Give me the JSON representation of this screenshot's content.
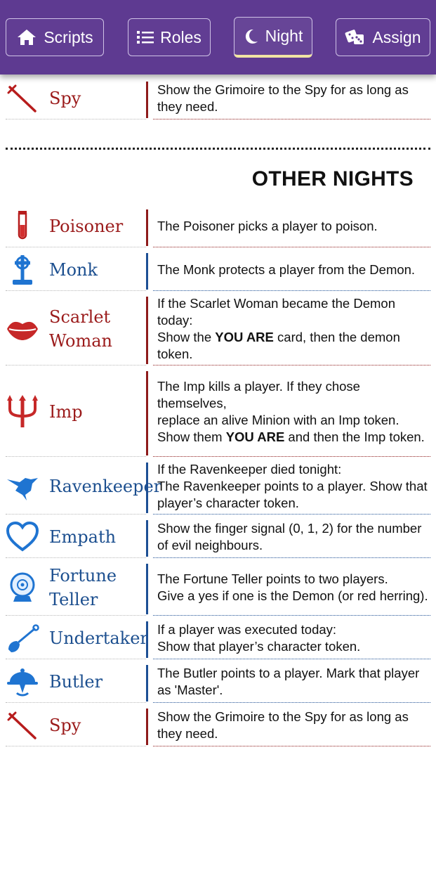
{
  "nav": {
    "scripts_label": "Scripts",
    "roles_label": "Roles",
    "night_label": "Night",
    "assign_label": "Assign",
    "active_tab": "Night",
    "bar_color": "#5e3a91"
  },
  "top_entry": {
    "name": "Spy",
    "icon": "dagger-icon",
    "team": "evil",
    "text": "Show the Grimoire to the Spy for as long as they need."
  },
  "section_title": "OTHER NIGHTS",
  "colors": {
    "evil": "#8e1b1b",
    "good": "#1d4f94"
  },
  "entries": [
    {
      "name": "Poisoner",
      "icon": "vial-icon",
      "team": "evil",
      "lines": [
        "The Poisoner picks a player to poison."
      ]
    },
    {
      "name": "Monk",
      "icon": "grave-cross-icon",
      "team": "good",
      "lines": [
        "The Monk protects a player from the Demon."
      ]
    },
    {
      "name": "Scarlet Woman",
      "icon": "lips-icon",
      "team": "evil",
      "lines": [
        "If the Scarlet Woman became the Demon today:"
      ],
      "pre_bold": "Show the ",
      "bold": "YOU ARE",
      "post_bold": " card, then the demon token."
    },
    {
      "name": "Imp",
      "icon": "trident-icon",
      "team": "evil",
      "lines": [
        "The Imp kills a player. If they chose themselves,",
        "replace an alive Minion with an Imp token."
      ],
      "pre_bold": "Show them ",
      "bold": "YOU ARE",
      "post_bold": " and then the Imp token."
    },
    {
      "name": "Ravenkeeper",
      "icon": "raven-icon",
      "team": "good",
      "lines": [
        "If the Ravenkeeper died tonight:",
        "The Ravenkeeper points to a player. Show that player’s character token."
      ]
    },
    {
      "name": "Empath",
      "icon": "heart-icon",
      "team": "good",
      "lines": [
        "Show the finger signal (0, 1, 2) for the number of evil neighbours."
      ]
    },
    {
      "name": "Fortune Teller",
      "icon": "crystal-ball-icon",
      "team": "good",
      "lines": [
        "The Fortune Teller points to two players.",
        "Give a yes if one is the Demon (or red herring)."
      ]
    },
    {
      "name": "Undertaker",
      "icon": "shovel-icon",
      "team": "good",
      "lines": [
        "If a player was executed today:",
        "Show that player’s character token."
      ]
    },
    {
      "name": "Butler",
      "icon": "cloche-icon",
      "team": "good",
      "lines": [
        "The Butler points to a player. Mark that player as 'Master'."
      ]
    },
    {
      "name": "Spy",
      "icon": "dagger-icon",
      "team": "evil",
      "lines": [
        "Show the Grimoire to the Spy for as long as they need."
      ]
    }
  ]
}
